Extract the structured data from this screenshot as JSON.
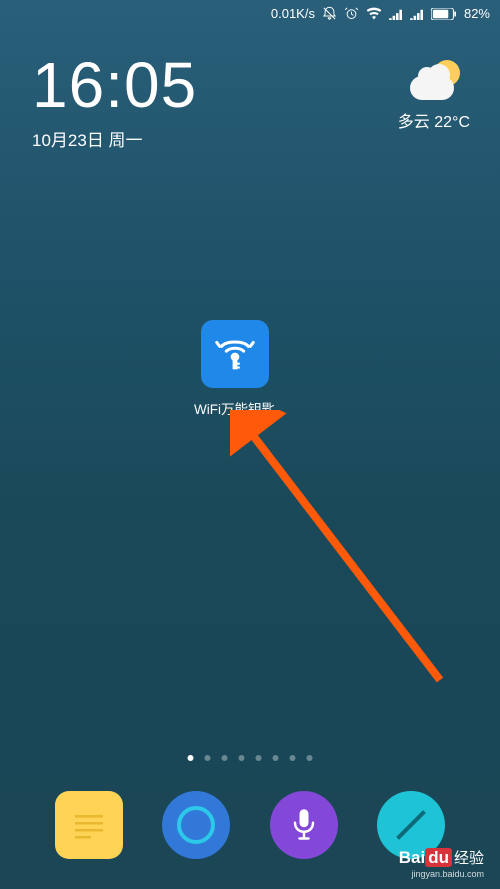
{
  "status_bar": {
    "speed": "0.01K/s",
    "battery_percent": "82%"
  },
  "clock": {
    "time": "16:05",
    "date": "10月23日 周一"
  },
  "weather": {
    "description": "多云  22°C"
  },
  "app": {
    "name": "WiFi万能钥匙"
  },
  "page_indicator": {
    "total": 8,
    "active": 0
  },
  "watermark": {
    "brand_prefix": "Bai",
    "brand_box": "du",
    "brand_suffix": "经验",
    "url": "jingyan.baidu.com"
  }
}
